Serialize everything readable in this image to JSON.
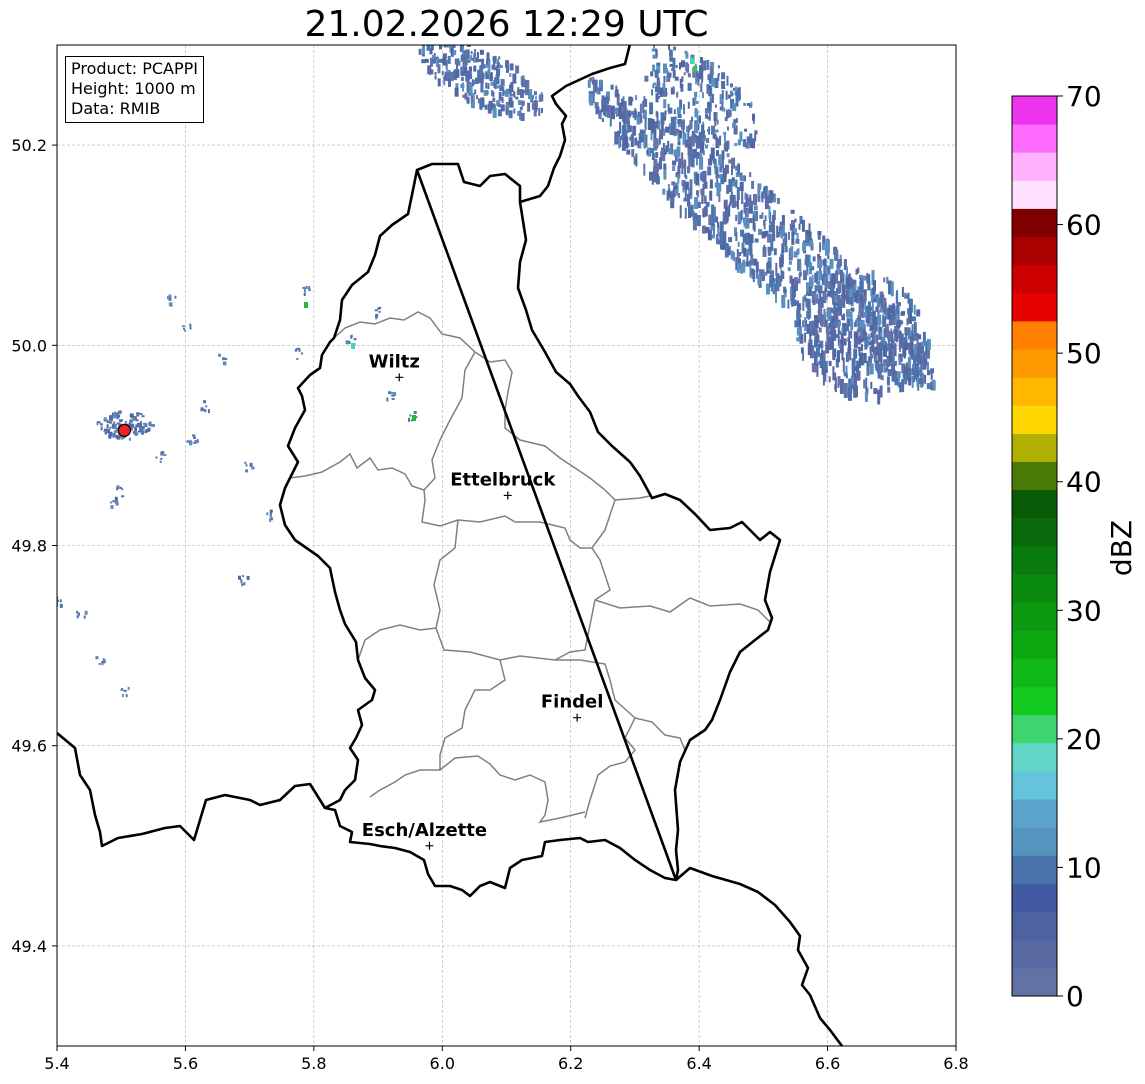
{
  "title": "21.02.2026 12:29 UTC",
  "info": {
    "product": "Product: PCAPPI",
    "height": "Height: 1000 m",
    "data": "Data: RMIB"
  },
  "map": {
    "lon_range": [
      5.4,
      6.8
    ],
    "lat_range": [
      49.3,
      50.3
    ],
    "x_ticks": [
      "5.4",
      "5.6",
      "5.8",
      "6.0",
      "6.2",
      "6.4",
      "6.6",
      "6.8"
    ],
    "y_ticks": [
      "49.4",
      "49.6",
      "49.8",
      "50.0",
      "50.2"
    ],
    "grid": true,
    "radar_site": {
      "lon": 5.505,
      "lat": 49.915,
      "color": "#ee2222"
    }
  },
  "cities": [
    {
      "name": "Wiltz",
      "lon": 5.933,
      "lat": 49.968
    },
    {
      "name": "Ettelbruck",
      "lon": 6.102,
      "lat": 49.85
    },
    {
      "name": "Findel",
      "lon": 6.21,
      "lat": 49.628
    },
    {
      "name": "Esch/Alzette",
      "lon": 5.98,
      "lat": 49.5
    }
  ],
  "colorbar": {
    "label": "dBZ",
    "min": 0,
    "max": 70,
    "tick_labels": [
      "0",
      "10",
      "20",
      "30",
      "40",
      "50",
      "60",
      "70"
    ],
    "colors": [
      "#6372a5",
      "#5868a0",
      "#4d62a0",
      "#425aa2",
      "#4a73ab",
      "#5494bf",
      "#5ca4cb",
      "#65c4dc",
      "#62d6c6",
      "#3ed46e",
      "#12c91d",
      "#10b818",
      "#0ea813",
      "#0d9912",
      "#0b8a10",
      "#0a7b0e",
      "#086a0a",
      "#085a07",
      "#4a7a06",
      "#b0b000",
      "#ffd700",
      "#ffb700",
      "#ff9900",
      "#ff7f00",
      "#e60000",
      "#cc0000",
      "#aa0000",
      "#800000",
      "#ffdfff",
      "#ffb0ff",
      "#ff6aff",
      "#ee33ee"
    ]
  }
}
